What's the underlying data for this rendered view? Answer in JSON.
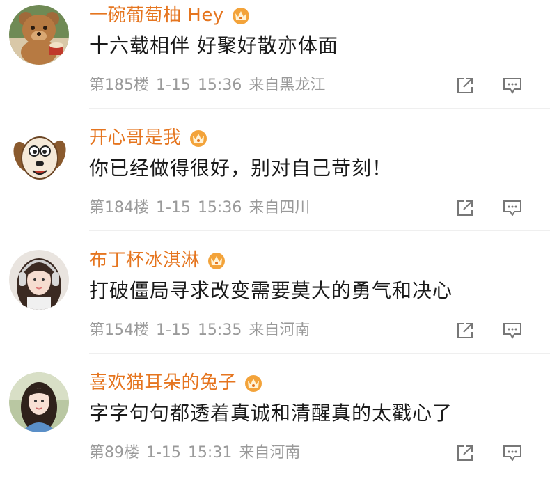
{
  "comments": [
    {
      "username": "一碗葡萄柚 Hey",
      "text": "十六载相伴 好聚好散亦体面",
      "floor": "第185楼",
      "date": "1-15",
      "time": "15:36",
      "location": "来自黑龙江",
      "avatar_desc": "teddy-bear-avatar"
    },
    {
      "username": "开心哥是我",
      "text": "你已经做得很好，别对自己苛刻！",
      "floor": "第184楼",
      "date": "1-15",
      "time": "15:36",
      "location": "来自四川",
      "avatar_desc": "cartoon-dog-avatar"
    },
    {
      "username": "布丁杯冰淇淋",
      "text": "打破僵局寻求改变需要莫大的勇气和决心",
      "floor": "第154楼",
      "date": "1-15",
      "time": "15:35",
      "location": "来自河南",
      "avatar_desc": "girl-headphones-avatar"
    },
    {
      "username": "喜欢猫耳朵的兔子",
      "text": "字字句句都透着真诚和清醒真的太戳心了",
      "floor": "第89楼",
      "date": "1-15",
      "time": "15:31",
      "location": "来自河南",
      "avatar_desc": "girl-portrait-avatar"
    }
  ],
  "colors": {
    "username": "#e5751f",
    "text": "#1a1a1a",
    "meta": "#9a9a9a",
    "badge": "#f3a33a"
  },
  "icons": {
    "badge": "crown-badge-icon",
    "share": "share-icon",
    "reply": "comment-icon"
  }
}
